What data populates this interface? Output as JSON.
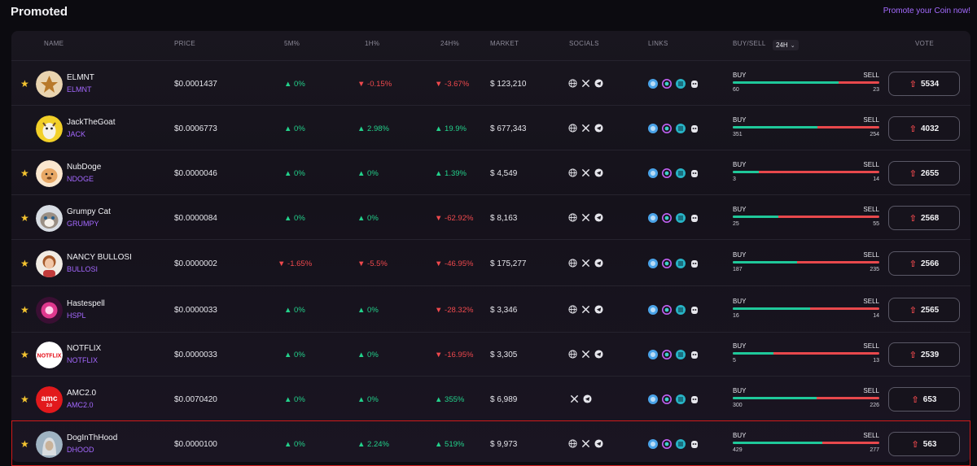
{
  "header": {
    "title": "Promoted",
    "promote_link": "Promote your Coin now!"
  },
  "columns": {
    "name": "NAME",
    "price": "PRICE",
    "m5": "5M%",
    "h1": "1H%",
    "h24": "24H%",
    "market": "MARKET",
    "socials": "SOCIALS",
    "links": "LINKS",
    "buysell": "BUY/SELL",
    "timeframe": "24H",
    "vote": "VOTE"
  },
  "colors": {
    "accent": "#a468ff",
    "up": "#23d18b",
    "down": "#f0494d",
    "buy_bar": "#1fc89a",
    "sell_bar": "#e8484c",
    "highlight": "#d11a1a"
  },
  "labels": {
    "buy": "BUY",
    "sell": "SELL"
  },
  "rows": [
    {
      "starred": true,
      "name": "ELMNT",
      "symbol": "ELMNT",
      "price": "$0.0001437",
      "m5": "0%",
      "m5_dir": "up",
      "h1": "-0.15%",
      "h1_dir": "down",
      "h24": "-3.67%",
      "h24_dir": "down",
      "market": "$ 123,210",
      "socials": [
        "globe-icon",
        "x-icon",
        "telegram-icon"
      ],
      "buy": "60",
      "sell": "23",
      "buy_ratio": 0.72,
      "votes": "5534",
      "avatar": "elmnt"
    },
    {
      "starred": false,
      "name": "JackTheGoat",
      "symbol": "JACK",
      "price": "$0.0006773",
      "m5": "0%",
      "m5_dir": "up",
      "h1": "2.98%",
      "h1_dir": "up",
      "h24": "19.9%",
      "h24_dir": "up",
      "market": "$ 677,343",
      "socials": [
        "globe-icon",
        "x-icon",
        "telegram-icon"
      ],
      "buy": "351",
      "sell": "254",
      "buy_ratio": 0.58,
      "votes": "4032",
      "avatar": "jack"
    },
    {
      "starred": true,
      "name": "NubDoge",
      "symbol": "NDOGE",
      "price": "$0.0000046",
      "m5": "0%",
      "m5_dir": "up",
      "h1": "0%",
      "h1_dir": "up",
      "h24": "1.39%",
      "h24_dir": "up",
      "market": "$ 4,549",
      "socials": [
        "globe-icon",
        "x-icon",
        "telegram-icon"
      ],
      "buy": "3",
      "sell": "14",
      "buy_ratio": 0.18,
      "votes": "2655",
      "avatar": "ndoge"
    },
    {
      "starred": true,
      "name": "Grumpy Cat",
      "symbol": "GRUMPY",
      "price": "$0.0000084",
      "m5": "0%",
      "m5_dir": "up",
      "h1": "0%",
      "h1_dir": "up",
      "h24": "-62.92%",
      "h24_dir": "down",
      "market": "$ 8,163",
      "socials": [
        "globe-icon",
        "x-icon",
        "telegram-icon"
      ],
      "buy": "25",
      "sell": "55",
      "buy_ratio": 0.31,
      "votes": "2568",
      "avatar": "grumpy"
    },
    {
      "starred": true,
      "name": "NANCY BULLOSI",
      "symbol": "BULLOSI",
      "price": "$0.0000002",
      "m5": "-1.65%",
      "m5_dir": "down",
      "h1": "-5.5%",
      "h1_dir": "down",
      "h24": "-46.95%",
      "h24_dir": "down",
      "market": "$ 175,277",
      "socials": [
        "globe-icon",
        "x-icon",
        "telegram-icon"
      ],
      "buy": "187",
      "sell": "235",
      "buy_ratio": 0.44,
      "votes": "2566",
      "avatar": "nancy"
    },
    {
      "starred": true,
      "name": "Hastespell",
      "symbol": "HSPL",
      "price": "$0.0000033",
      "m5": "0%",
      "m5_dir": "up",
      "h1": "0%",
      "h1_dir": "up",
      "h24": "-28.32%",
      "h24_dir": "down",
      "market": "$ 3,346",
      "socials": [
        "globe-icon",
        "x-icon",
        "telegram-icon"
      ],
      "buy": "16",
      "sell": "14",
      "buy_ratio": 0.53,
      "votes": "2565",
      "avatar": "hspl"
    },
    {
      "starred": true,
      "name": "NOTFLIX",
      "symbol": "NOTFLIX",
      "price": "$0.0000033",
      "m5": "0%",
      "m5_dir": "up",
      "h1": "0%",
      "h1_dir": "up",
      "h24": "-16.95%",
      "h24_dir": "down",
      "market": "$ 3,305",
      "socials": [
        "globe-icon",
        "x-icon",
        "telegram-icon"
      ],
      "buy": "5",
      "sell": "13",
      "buy_ratio": 0.28,
      "votes": "2539",
      "avatar": "notflix"
    },
    {
      "starred": true,
      "name": "AMC2.0",
      "symbol": "AMC2.0",
      "price": "$0.0070420",
      "m5": "0%",
      "m5_dir": "up",
      "h1": "0%",
      "h1_dir": "up",
      "h24": "355%",
      "h24_dir": "up",
      "market": "$ 6,989",
      "socials": [
        "x-icon",
        "telegram-icon"
      ],
      "buy": "300",
      "sell": "226",
      "buy_ratio": 0.57,
      "votes": "653",
      "avatar": "amc"
    },
    {
      "starred": true,
      "name": "DogInThHood",
      "symbol": "DHOOD",
      "price": "$0.0000100",
      "m5": "0%",
      "m5_dir": "up",
      "h1": "2.24%",
      "h1_dir": "up",
      "h24": "519%",
      "h24_dir": "up",
      "market": "$ 9,973",
      "socials": [
        "globe-icon",
        "x-icon",
        "telegram-icon"
      ],
      "buy": "429",
      "sell": "277",
      "buy_ratio": 0.61,
      "votes": "563",
      "avatar": "dhood",
      "highlighted": true
    }
  ]
}
